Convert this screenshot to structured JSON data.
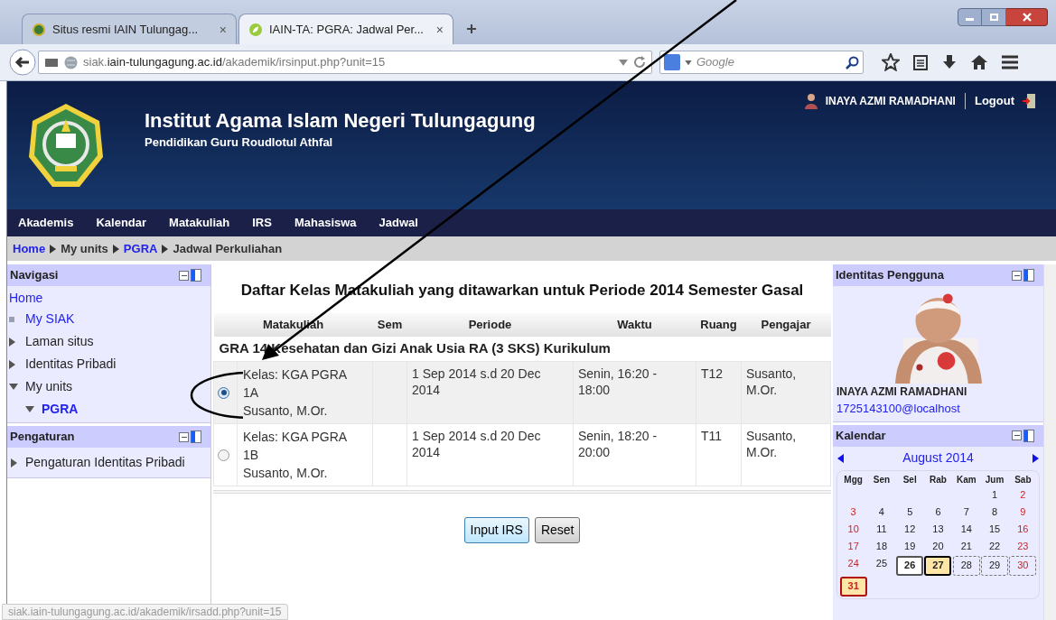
{
  "browser": {
    "tabs": [
      {
        "title": "Situs resmi IAIN Tulungag...",
        "close": "×",
        "selected": false
      },
      {
        "title": "IAIN-TA: PGRA: Jadwal Per...",
        "close": "×",
        "selected": true
      }
    ],
    "address": {
      "prefix": "siak.",
      "host": "iain-tulungagung.ac.id",
      "path": "/akademik/irsinput.php?unit=15"
    },
    "search": {
      "placeholder": "Google"
    }
  },
  "header": {
    "title": "Institut Agama Islam Negeri Tulungagung",
    "subtitle": "Pendidikan Guru Roudlotul Athfal",
    "user": "INAYA AZMI RAMADHANI",
    "logout": "Logout"
  },
  "menu": [
    "Akademis",
    "Kalendar",
    "Matakuliah",
    "IRS",
    "Mahasiswa",
    "Jadwal"
  ],
  "breadcrumb": [
    {
      "label": "Home",
      "link": true
    },
    {
      "label": "My units",
      "link": false
    },
    {
      "label": "PGRA",
      "link": true
    },
    {
      "label": "Jadwal Perkuliahan",
      "link": false
    }
  ],
  "navigation": {
    "title": "Navigasi",
    "root": {
      "label": "Home",
      "link": true
    },
    "items": [
      {
        "label": "My SIAK",
        "link": true,
        "kind": "leaf"
      },
      {
        "label": "Laman situs",
        "link": false,
        "kind": "branch",
        "expanded": false
      },
      {
        "label": "Identitas Pribadi",
        "link": false,
        "kind": "branch",
        "expanded": false
      },
      {
        "label": "My units",
        "link": false,
        "kind": "branch",
        "expanded": true,
        "children": [
          {
            "label": "PGRA",
            "link": true,
            "kind": "branch",
            "expanded": true
          }
        ]
      }
    ]
  },
  "settings": {
    "title": "Pengaturan",
    "items": [
      {
        "label": "Pengaturan Identitas Pribadi",
        "expanded": false
      }
    ]
  },
  "main": {
    "title": "Daftar Kelas Matakuliah yang ditawarkan untuk Periode 2014 Semester Gasal",
    "columns": [
      "Matakuliah",
      "Sem",
      "Periode",
      "Waktu",
      "Ruang",
      "Pengajar"
    ],
    "course": "GRA 14 Kesehatan dan Gizi Anak Usia RA (3 SKS) Kurikulum",
    "rows": [
      {
        "selected": true,
        "kelas": "Kelas: KGA PGRA 1A",
        "dosen": "Susanto, M.Or.",
        "periode": "1 Sep 2014 s.d 20 Dec 2014",
        "waktu": "Senin, 16:20 - 18:00",
        "ruang": "T12",
        "pengajar": "Susanto, M.Or."
      },
      {
        "selected": false,
        "kelas": "Kelas: KGA PGRA 1B",
        "dosen": "Susanto, M.Or.",
        "periode": "1 Sep 2014 s.d 20 Dec 2014",
        "waktu": "Senin, 18:20 - 20:00",
        "ruang": "T11",
        "pengajar": "Susanto, M.Or."
      }
    ],
    "buttons": [
      {
        "label": "Input IRS",
        "focused": true
      },
      {
        "label": "Reset",
        "focused": false
      }
    ]
  },
  "identity": {
    "title": "Identitas Pengguna",
    "name": "INAYA AZMI RAMADHANI",
    "email": "1725143100@localhost"
  },
  "calendar": {
    "title": "Kalendar",
    "month": "August 2014",
    "weekdays": [
      "Mgg",
      "Sen",
      "Sel",
      "Rab",
      "Kam",
      "Jum",
      "Sab"
    ],
    "weeks": [
      [
        {
          "kind": "blank"
        },
        {
          "kind": "blank"
        },
        {
          "kind": "blank"
        },
        {
          "kind": "blank"
        },
        {
          "kind": "blank"
        },
        {
          "d": "1",
          "weekend": false,
          "kind": "plain"
        },
        {
          "d": "2",
          "weekend": true,
          "kind": "plain"
        }
      ],
      [
        {
          "d": "3",
          "weekend": true,
          "kind": "plain"
        },
        {
          "d": "4",
          "weekend": false,
          "kind": "plain"
        },
        {
          "d": "5",
          "weekend": false,
          "kind": "plain"
        },
        {
          "d": "6",
          "weekend": false,
          "kind": "plain"
        },
        {
          "d": "7",
          "weekend": false,
          "kind": "plain"
        },
        {
          "d": "8",
          "weekend": false,
          "kind": "plain"
        },
        {
          "d": "9",
          "weekend": true,
          "kind": "plain"
        }
      ],
      [
        {
          "d": "10",
          "weekend": true,
          "kind": "plain"
        },
        {
          "d": "11",
          "weekend": false,
          "kind": "plain"
        },
        {
          "d": "12",
          "weekend": false,
          "kind": "plain"
        },
        {
          "d": "13",
          "weekend": false,
          "kind": "plain"
        },
        {
          "d": "14",
          "weekend": false,
          "kind": "plain"
        },
        {
          "d": "15",
          "weekend": false,
          "kind": "plain"
        },
        {
          "d": "16",
          "weekend": true,
          "kind": "plain"
        }
      ],
      [
        {
          "d": "17",
          "weekend": true,
          "kind": "plain"
        },
        {
          "d": "18",
          "weekend": false,
          "kind": "plain"
        },
        {
          "d": "19",
          "weekend": false,
          "kind": "plain"
        },
        {
          "d": "20",
          "weekend": false,
          "kind": "plain"
        },
        {
          "d": "21",
          "weekend": false,
          "kind": "plain"
        },
        {
          "d": "22",
          "weekend": false,
          "kind": "plain"
        },
        {
          "d": "23",
          "weekend": true,
          "kind": "plain"
        }
      ],
      [
        {
          "d": "24",
          "weekend": true,
          "kind": "plain"
        },
        {
          "d": "25",
          "weekend": false,
          "kind": "plain"
        },
        {
          "d": "26",
          "weekend": false,
          "kind": "outlined"
        },
        {
          "d": "27",
          "weekend": false,
          "kind": "today"
        },
        {
          "d": "28",
          "weekend": false,
          "kind": "dashed"
        },
        {
          "d": "29",
          "weekend": false,
          "kind": "dashed"
        },
        {
          "d": "30",
          "weekend": true,
          "kind": "dashed"
        }
      ],
      [
        {
          "d": "31",
          "weekend": true,
          "kind": "event"
        }
      ]
    ]
  },
  "status_bar": "siak.iain-tulungagung.ac.id/akademik/irsadd.php?unit=15"
}
